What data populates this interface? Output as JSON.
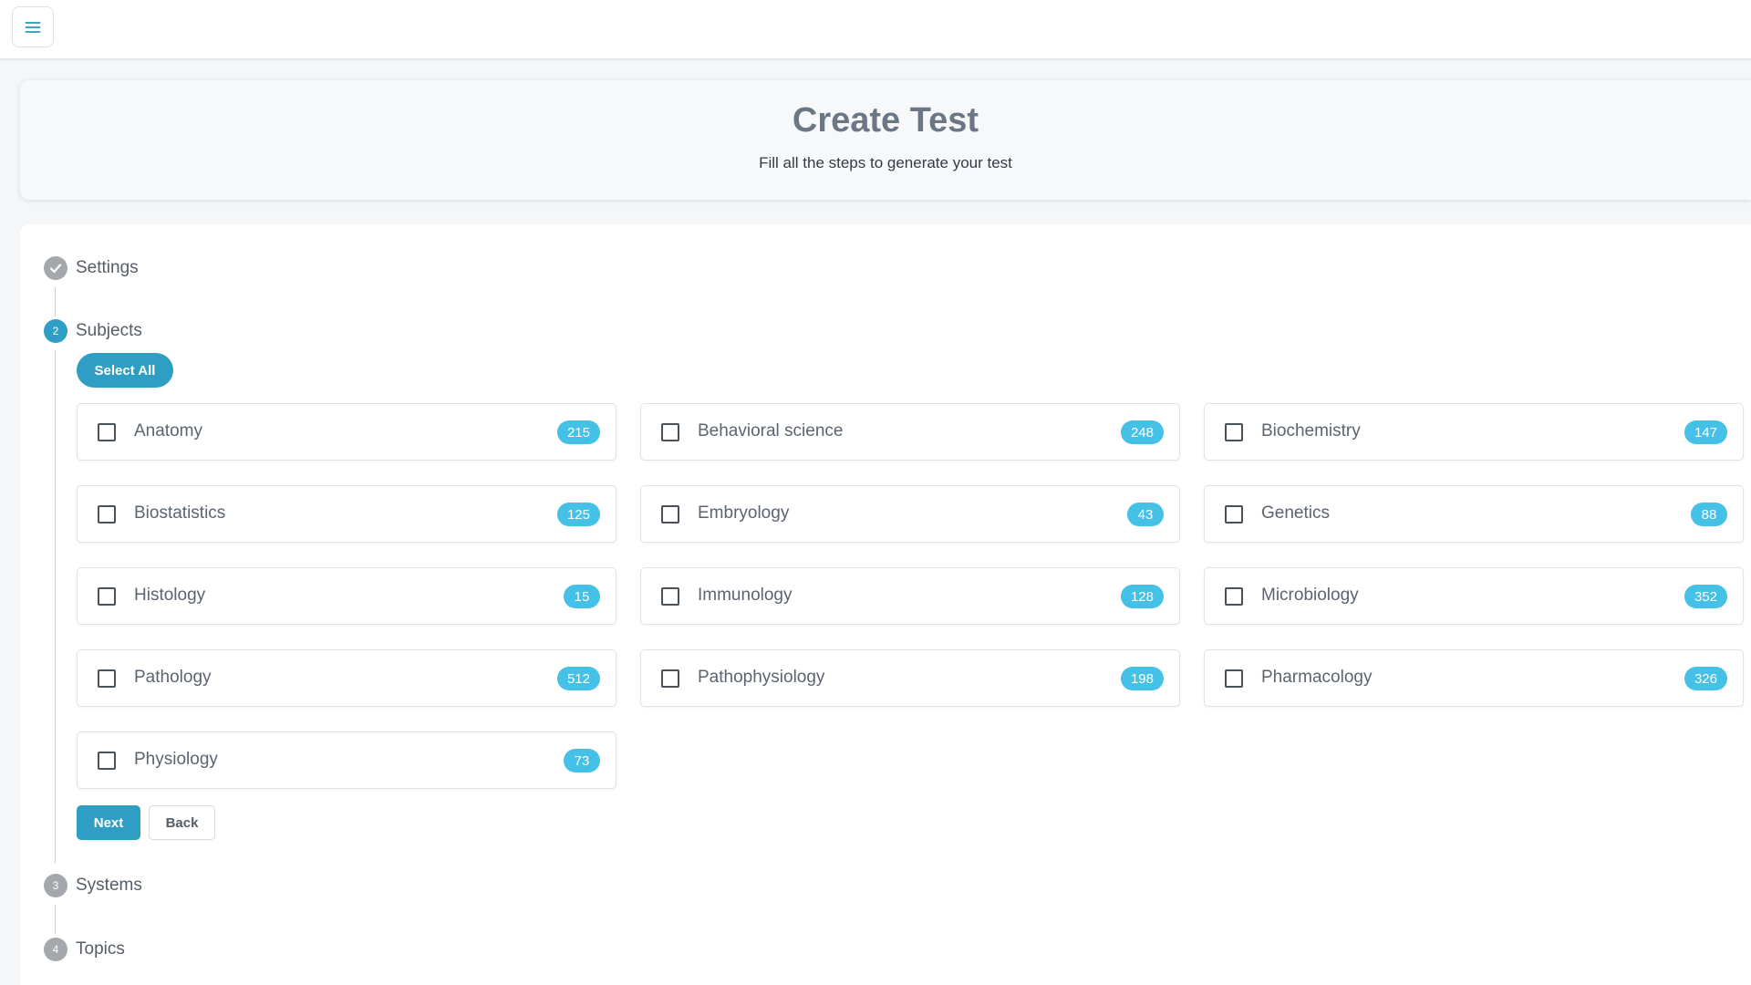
{
  "header": {
    "title": "Create Test",
    "subtitle": "Fill all the steps to generate your test"
  },
  "steps": [
    {
      "number": "",
      "label": "Settings",
      "status": "completed",
      "icon": "check-icon"
    },
    {
      "number": "2",
      "label": "Subjects",
      "status": "active"
    },
    {
      "number": "3",
      "label": "Systems",
      "status": "pending"
    },
    {
      "number": "4",
      "label": "Topics",
      "status": "pending"
    }
  ],
  "subjects_step": {
    "select_all_label": "Select All",
    "subjects": [
      {
        "name": "Anatomy",
        "count": "215",
        "checked": false
      },
      {
        "name": "Behavioral science",
        "count": "248",
        "checked": false
      },
      {
        "name": "Biochemistry",
        "count": "147",
        "checked": false
      },
      {
        "name": "Biostatistics",
        "count": "125",
        "checked": false
      },
      {
        "name": "Embryology",
        "count": "43",
        "checked": false
      },
      {
        "name": "Genetics",
        "count": "88",
        "checked": false
      },
      {
        "name": "Histology",
        "count": "15",
        "checked": false
      },
      {
        "name": "Immunology",
        "count": "128",
        "checked": false
      },
      {
        "name": "Microbiology",
        "count": "352",
        "checked": false
      },
      {
        "name": "Pathology",
        "count": "512",
        "checked": false
      },
      {
        "name": "Pathophysiology",
        "count": "198",
        "checked": false
      },
      {
        "name": "Pharmacology",
        "count": "326",
        "checked": false
      },
      {
        "name": "Physiology",
        "count": "73",
        "checked": false
      }
    ],
    "next_label": "Next",
    "back_label": "Back"
  },
  "colors": {
    "accent": "#2f9ec4",
    "badge": "#45c0e6",
    "step_inactive": "#a4a8ad"
  }
}
